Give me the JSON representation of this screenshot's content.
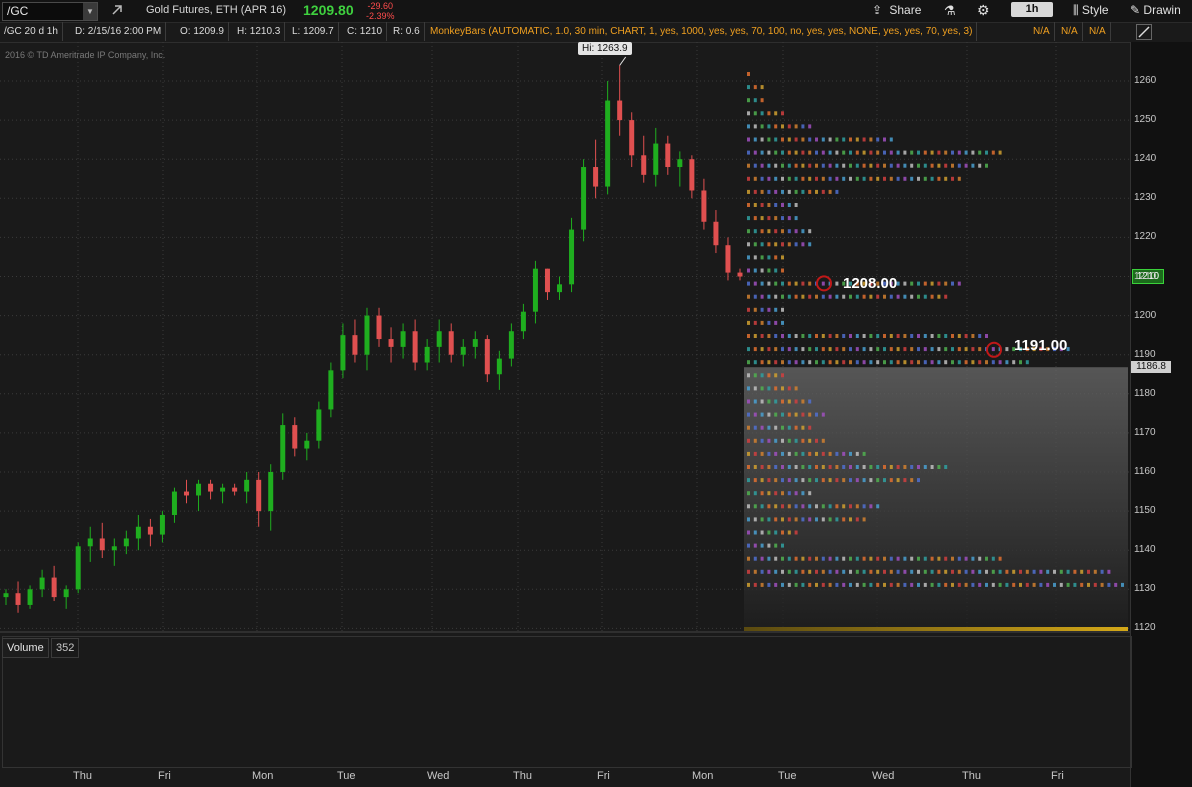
{
  "toolbar": {
    "symbol": "/GC",
    "instrument_description": "Gold Futures, ETH (APR 16)",
    "last_price": "1209.80",
    "net_change": "-29.60",
    "net_change_pct": "-2.39%",
    "share_label": "Share",
    "aggregation_label": "1h",
    "style_label": "Style",
    "drawings_label": "Drawin"
  },
  "header": {
    "chart_period": "/GC 20 d 1h",
    "date": "D: 2/15/16 2:00 PM",
    "open": "O: 1209.9",
    "high": "H: 1210.3",
    "low": "L: 1209.7",
    "close": "C: 1210",
    "range": "R: 0.6",
    "study": "MonkeyBars (AUTOMATIC, 1.0, 30 min, CHART, 1, yes, 1000, yes, yes, 70, 100, no, yes, yes, NONE, yes, yes, 70, yes, 3)",
    "na_values": [
      "N/A",
      "N/A",
      "N/A"
    ]
  },
  "copyright": "2016 © TD Ameritrade IP Company, Inc.",
  "chart": {
    "high_label": "Hi: 1263.9",
    "monkeybar_level_1": "1208.00",
    "monkeybar_level_2": "1191.00",
    "last_price_tag": "1210",
    "cursor_price_tag": "1186.8",
    "y_ticks": [
      "1260",
      "1250",
      "1240",
      "1230",
      "1220",
      "1210",
      "1200",
      "1190",
      "1180",
      "1170",
      "1160",
      "1150",
      "1140",
      "1130",
      "1120"
    ],
    "x_ticks": [
      "Thu",
      "Fri",
      "Mon",
      "Tue",
      "Wed",
      "Thu",
      "Fri",
      "Mon",
      "Tue",
      "Wed",
      "Thu",
      "Fri"
    ],
    "colors": {
      "up": "#1fae1f",
      "down": "#e05050",
      "background": "#1a1a1a",
      "grid": "#3a3a3a"
    }
  },
  "volume": {
    "label": "Volume",
    "value": "352"
  },
  "chart_data": {
    "type": "candlestick",
    "title": "/GC 20 d 1h",
    "ylim": [
      1118,
      1268
    ],
    "y_ticks": [
      1260,
      1250,
      1240,
      1230,
      1220,
      1210,
      1200,
      1190,
      1180,
      1170,
      1160,
      1150,
      1140,
      1130,
      1120
    ],
    "x_ticks": [
      "Thu",
      "Fri",
      "Mon",
      "Tue",
      "Wed",
      "Thu",
      "Fri",
      "Mon",
      "Tue",
      "Wed",
      "Thu",
      "Fri"
    ],
    "ohlc": [
      [
        1128,
        1130,
        1126,
        1129
      ],
      [
        1129,
        1132,
        1124,
        1126
      ],
      [
        1126,
        1131,
        1125,
        1130
      ],
      [
        1130,
        1135,
        1128,
        1133
      ],
      [
        1133,
        1136,
        1127,
        1128
      ],
      [
        1128,
        1131,
        1125,
        1130
      ],
      [
        1130,
        1142,
        1129,
        1141
      ],
      [
        1141,
        1146,
        1137,
        1143
      ],
      [
        1143,
        1147,
        1138,
        1140
      ],
      [
        1140,
        1143,
        1136,
        1141
      ],
      [
        1141,
        1145,
        1139,
        1143
      ],
      [
        1143,
        1149,
        1140,
        1146
      ],
      [
        1146,
        1148,
        1141,
        1144
      ],
      [
        1144,
        1150,
        1142,
        1149
      ],
      [
        1149,
        1156,
        1147,
        1155
      ],
      [
        1155,
        1158,
        1152,
        1154
      ],
      [
        1154,
        1158,
        1150,
        1157
      ],
      [
        1157,
        1158,
        1153,
        1155
      ],
      [
        1155,
        1157,
        1152,
        1156
      ],
      [
        1156,
        1157,
        1154,
        1155
      ],
      [
        1155,
        1160,
        1152,
        1158
      ],
      [
        1158,
        1160,
        1146,
        1150
      ],
      [
        1150,
        1162,
        1145,
        1160
      ],
      [
        1160,
        1175,
        1158,
        1172
      ],
      [
        1172,
        1174,
        1164,
        1166
      ],
      [
        1166,
        1170,
        1163,
        1168
      ],
      [
        1168,
        1178,
        1166,
        1176
      ],
      [
        1176,
        1188,
        1174,
        1186
      ],
      [
        1186,
        1198,
        1184,
        1195
      ],
      [
        1195,
        1199,
        1188,
        1190
      ],
      [
        1190,
        1202,
        1186,
        1200
      ],
      [
        1200,
        1202,
        1192,
        1194
      ],
      [
        1194,
        1197,
        1188,
        1192
      ],
      [
        1192,
        1198,
        1189,
        1196
      ],
      [
        1196,
        1199,
        1186,
        1188
      ],
      [
        1188,
        1194,
        1186,
        1192
      ],
      [
        1192,
        1199,
        1188,
        1196
      ],
      [
        1196,
        1198,
        1188,
        1190
      ],
      [
        1190,
        1194,
        1187,
        1192
      ],
      [
        1192,
        1196,
        1189,
        1194
      ],
      [
        1194,
        1195,
        1183,
        1185
      ],
      [
        1185,
        1191,
        1181,
        1189
      ],
      [
        1189,
        1198,
        1187,
        1196
      ],
      [
        1196,
        1203,
        1194,
        1201
      ],
      [
        1201,
        1214,
        1198,
        1212
      ],
      [
        1212,
        1212,
        1204,
        1206
      ],
      [
        1206,
        1210,
        1204,
        1208
      ],
      [
        1208,
        1225,
        1206,
        1222
      ],
      [
        1222,
        1240,
        1219,
        1238
      ],
      [
        1238,
        1245,
        1230,
        1233
      ],
      [
        1233,
        1260,
        1231,
        1255
      ],
      [
        1255,
        1264,
        1246,
        1250
      ],
      [
        1250,
        1252,
        1238,
        1241
      ],
      [
        1241,
        1246,
        1234,
        1236
      ],
      [
        1236,
        1248,
        1233,
        1244
      ],
      [
        1244,
        1246,
        1236,
        1238
      ],
      [
        1238,
        1242,
        1233,
        1240
      ],
      [
        1240,
        1241,
        1230,
        1232
      ],
      [
        1232,
        1235,
        1222,
        1224
      ],
      [
        1224,
        1227,
        1216,
        1218
      ],
      [
        1218,
        1220,
        1209,
        1211
      ],
      [
        1211,
        1212,
        1209,
        1210
      ]
    ]
  }
}
